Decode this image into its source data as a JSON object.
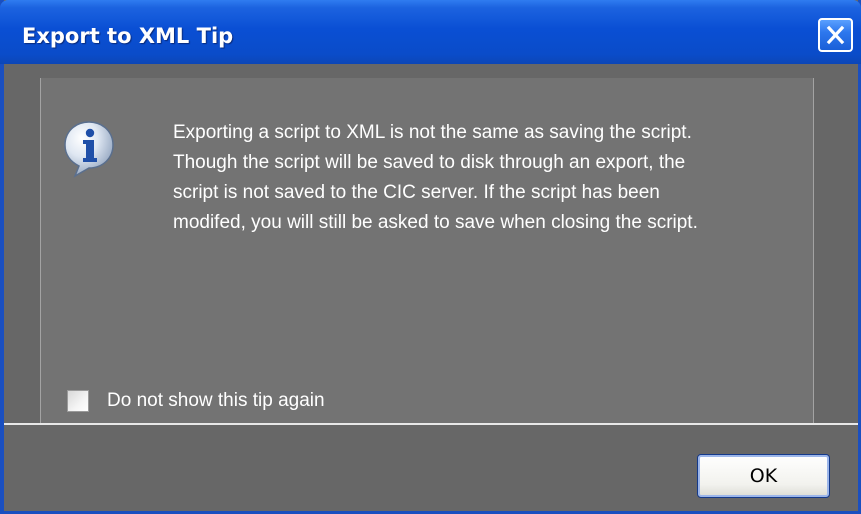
{
  "window": {
    "title": "Export to XML Tip"
  },
  "icons": {
    "info": "info-icon",
    "close": "close-icon"
  },
  "message": {
    "lines": [
      "Exporting a script to XML is not the same as saving the script.",
      "Though the script will be saved to disk through an export, the",
      "script is not saved to the CIC server. If the script has been",
      "modifed, you will still be asked to save when closing the script."
    ]
  },
  "options": {
    "dont_show_label": "Do not show this tip again",
    "dont_show_checked": false
  },
  "buttons": {
    "ok_label": "OK"
  },
  "colors": {
    "titlebar": "#0a4fd4",
    "dialog_background": "#676767",
    "panel_background": "#737373",
    "text": "#ffffff"
  }
}
